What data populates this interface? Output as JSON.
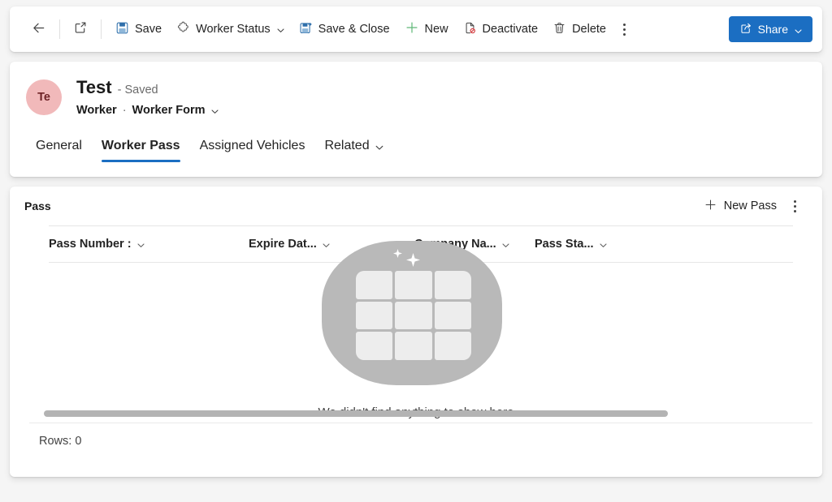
{
  "commandbar": {
    "back_label": "Back",
    "popout_label": "Open in new window",
    "save_label": "Save",
    "worker_status_label": "Worker Status",
    "save_close_label": "Save & Close",
    "new_label": "New",
    "deactivate_label": "Deactivate",
    "delete_label": "Delete",
    "more_label": "More commands",
    "share_label": "Share"
  },
  "record": {
    "avatar_initials": "Te",
    "title": "Test",
    "saved_state": "- Saved",
    "entity": "Worker",
    "separator": "·",
    "form_name": "Worker Form"
  },
  "tabs": [
    {
      "label": "General",
      "selected": false,
      "has_chevron": false
    },
    {
      "label": "Worker Pass",
      "selected": true,
      "has_chevron": false
    },
    {
      "label": "Assigned Vehicles",
      "selected": false,
      "has_chevron": false
    },
    {
      "label": "Related",
      "selected": false,
      "has_chevron": true
    }
  ],
  "subgrid": {
    "label": "Pass",
    "new_button_label": "New Pass",
    "more_label": "More commands",
    "columns": [
      {
        "label": "Pass Number :"
      },
      {
        "label": "Expire Dat..."
      },
      {
        "label": "Company Na..."
      },
      {
        "label": "Pass Sta..."
      }
    ],
    "empty_message": "We didn't find anything to show here",
    "rows_label": "Rows: 0"
  },
  "colors": {
    "accent": "#1b6ec2",
    "page_background": "#f5f5f5",
    "card_background": "#ffffff",
    "avatar_background": "#f1b9ba",
    "avatar_text": "#6e2226",
    "new_icon_green": "#5fb878",
    "deactivate_badge_red": "#d13438",
    "empty_blob_gray": "#b9b9b9"
  },
  "icons": {
    "back": "back-arrow-icon",
    "popout": "open-in-new-window-icon",
    "save": "floppy-disk-icon",
    "worker_status": "puzzle-piece-icon",
    "save_close": "floppy-disk-arrow-icon",
    "new": "plus-icon",
    "deactivate": "document-blocked-icon",
    "delete": "trash-can-icon",
    "more": "overflow-dots-icon",
    "share": "share-icon",
    "chevron": "chevron-down-icon",
    "empty_state": "empty-grid-illustration-icon"
  }
}
